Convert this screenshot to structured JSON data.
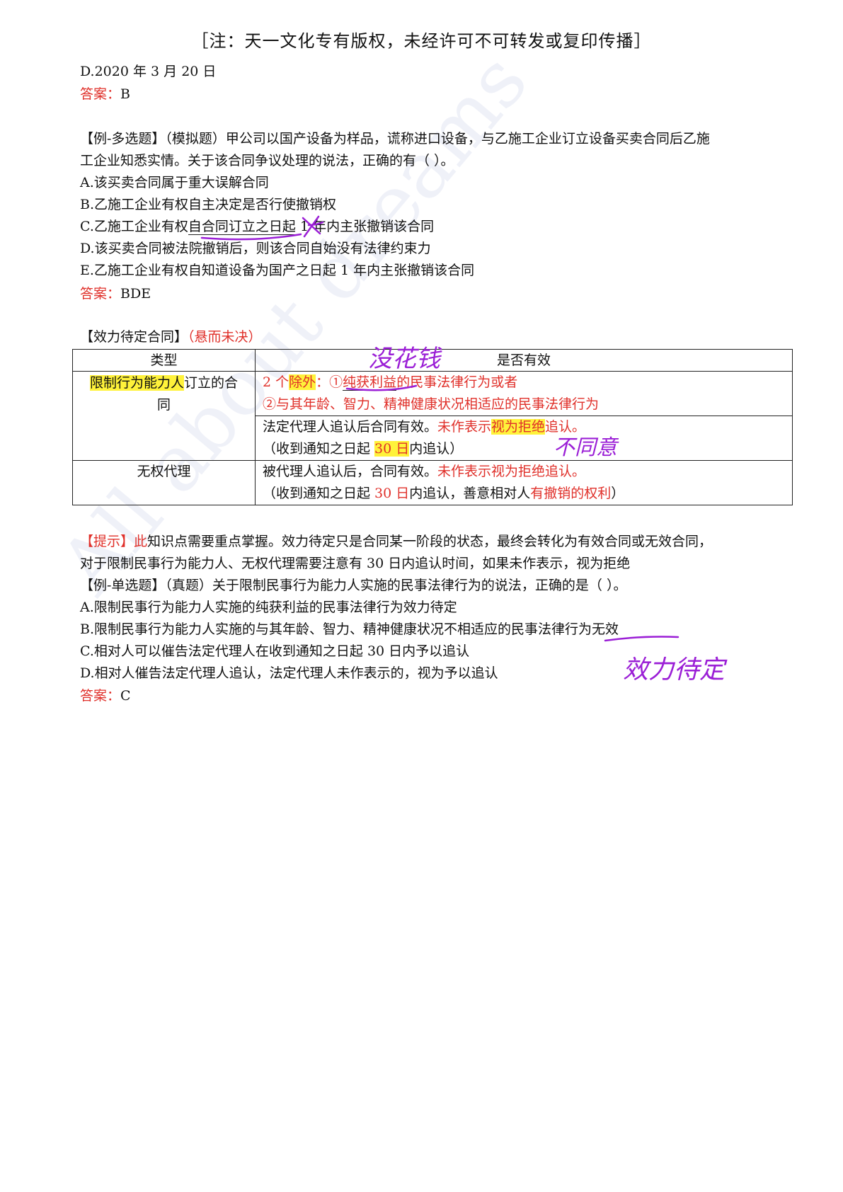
{
  "header": "［注：天一文化专有版权，未经许可不可转发或复印传播］",
  "watermark": "All about dreams",
  "q1_tail": {
    "option_d": "D.2020 年 3 月 20 日",
    "answer_label": "答案：",
    "answer": "B"
  },
  "q2": {
    "stem_line1": "【例-多选题】（模拟题）甲公司以国产设备为样品，谎称进口设备，与乙施工企业订立设备买卖合同后乙施",
    "stem_line2": "工企业知悉实情。关于该合同争议处理的说法，正确的有（ ）。",
    "option_a": "A.该买卖合同属于重大误解合同",
    "option_b": "B.乙施工企业有权自主决定是否行使撤销权",
    "option_c_pre": "C.乙施工企业有权",
    "option_c_ul": "自合同订立之日起",
    "option_c_post": " 1 年内主张撤销该合同",
    "option_d": "D.该买卖合同被法院撤销后，则该合同自始没有法律约束力",
    "option_e": "E.乙施工企业有权自知道设备为国产之日起 1 年内主张撤销该合同",
    "answer_label": "答案：",
    "answer": "BDE"
  },
  "section": {
    "title": "【效力待定合同】",
    "subtitle": "（悬而未决）"
  },
  "table": {
    "head_type": "类型",
    "head_valid": "是否有效",
    "row1": {
      "type_hl": "限制行为能力人",
      "type_rest1": "订立的合",
      "type_rest2": "同",
      "a_pre": "2 个",
      "a_hl": "除外",
      "a_mid": "：①",
      "a_ul": "纯获利益",
      "a_post": "的民事法律行为或者",
      "b_line": "②与其年龄、智力、精神健康状况相适应的民事法律行为",
      "c_pre": "法定代理人追认后合同有效。",
      "c_red": "未作表示",
      "c_hl": "视为拒绝",
      "c_end": "追认。",
      "d_pre": "（收到通知之日起 ",
      "d_hl": "30 日",
      "d_post": "内追认）"
    },
    "row2": {
      "type": "无权代理",
      "a_pre": "被代理人追认后，合同有效。",
      "a_red": "未作表示视为拒绝追认。",
      "b_pre": "（收到通知之日起 ",
      "b_red": "30 日",
      "b_mid": "内追认，善意相对人",
      "b_red2": "有撤销的权利",
      "b_end": "）"
    }
  },
  "tip": {
    "label": "【提示】",
    "word": "此",
    "line1": "知识点需要重点掌握。效力待定只是合同某一阶段的状态，最终会转化为有效合同或无效合同，",
    "line2": "对于限制民事行为能力人、无权代理需要注意有 30 日内追认时间，如果未作表示，视为拒绝"
  },
  "q3": {
    "stem": "【例-单选题】（真题）关于限制民事行为能力人实施的民事法律行为的说法，正确的是（ ）。",
    "option_a": "A.限制民事行为能力人实施的纯获利益的民事法律行为效力待定",
    "option_b_pre": "B.限制民事行为能力人实施的与其年龄、智力、精神健康状况不相适应的民事法",
    "option_b_ul": "律行为无效",
    "option_c": "C.相对人可以催告法定代理人在收到通知之日起 30 日内予以追认",
    "option_d": "D.相对人催告法定代理人追认，法定代理人未作表示的，视为予以追认",
    "answer_label": "答案：",
    "answer": "C"
  },
  "annotations": {
    "note1": "没花钱",
    "note2": "不同意",
    "note3": "效力待定",
    "ink_color": "#9b1fd6"
  }
}
